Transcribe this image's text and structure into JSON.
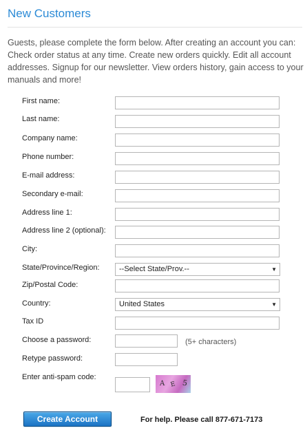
{
  "page": {
    "title": "New Customers",
    "intro": "Guests, please complete the form below. After creating an account you can: Check order status at any time. Create new orders quickly. Edit all account addresses. Signup for our newsletter. View orders history, gain access to your manuals and more!"
  },
  "form": {
    "first_name": {
      "label": "First name:",
      "value": ""
    },
    "last_name": {
      "label": "Last name:",
      "value": ""
    },
    "company_name": {
      "label": "Company name:",
      "value": ""
    },
    "phone_number": {
      "label": "Phone number:",
      "value": ""
    },
    "email": {
      "label": "E-mail address:",
      "value": ""
    },
    "secondary_email": {
      "label": "Secondary e-mail:",
      "value": ""
    },
    "address_line_1": {
      "label": "Address line 1:",
      "value": ""
    },
    "address_line_2": {
      "label": "Address line 2 (optional):",
      "value": ""
    },
    "city": {
      "label": "City:",
      "value": ""
    },
    "state": {
      "label": "State/Province/Region:",
      "selected": "--Select State/Prov.--"
    },
    "zip": {
      "label": "Zip/Postal Code:",
      "value": ""
    },
    "country": {
      "label": "Country:",
      "selected": "United States"
    },
    "tax_id": {
      "label": "Tax ID",
      "value": ""
    },
    "password": {
      "label": "Choose a password:",
      "value": "",
      "hint": "(5+ characters)"
    },
    "retype_password": {
      "label": "Retype password:",
      "value": ""
    },
    "anti_spam": {
      "label": "Enter anti-spam code:",
      "value": "",
      "captcha_text": "AE5"
    }
  },
  "actions": {
    "create_account_label": "Create Account",
    "help_text": "For help. Please call 877-671-7173"
  },
  "icons": {
    "select_caret": "triangle-down-icon"
  },
  "colors": {
    "title": "#2b8ad6",
    "button_top": "#4aa8e8",
    "button_bottom": "#1b73c4",
    "input_border": "#b5b5b5"
  }
}
